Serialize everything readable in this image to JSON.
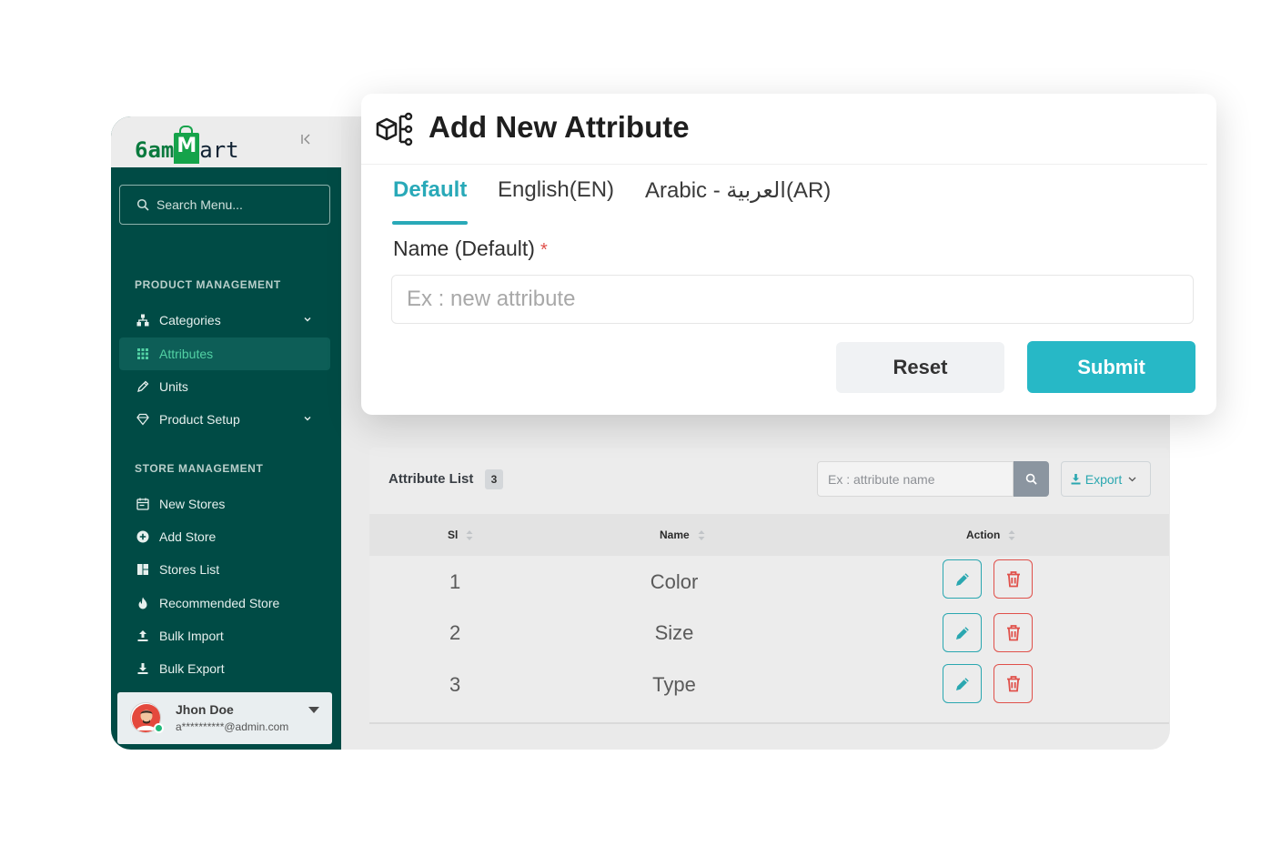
{
  "brand": {
    "logo_prefix": "6am",
    "logo_m": "M",
    "logo_suffix": "art",
    "collapse_icon": "collapse-left-icon"
  },
  "sidebar": {
    "search_placeholder": "Search Menu...",
    "sections": [
      {
        "label": "PRODUCT MANAGEMENT",
        "items": [
          {
            "label": "Categories",
            "icon": "sitemap-icon",
            "has_chevron": true
          },
          {
            "label": "Attributes",
            "icon": "grid-icon",
            "active": true
          },
          {
            "label": "Units",
            "icon": "ruler-pencil-icon"
          },
          {
            "label": "Product Setup",
            "icon": "diamond-icon",
            "has_chevron": true
          }
        ]
      },
      {
        "label": "STORE MANAGEMENT",
        "items": [
          {
            "label": "New Stores",
            "icon": "calendar-icon"
          },
          {
            "label": "Add Store",
            "icon": "plus-circle-icon"
          },
          {
            "label": "Stores List",
            "icon": "layout-icon"
          },
          {
            "label": "Recommended Store",
            "icon": "flame-icon"
          },
          {
            "label": "Bulk Import",
            "icon": "upload-icon"
          },
          {
            "label": "Bulk Export",
            "icon": "download-icon"
          }
        ]
      }
    ],
    "user": {
      "name": "Jhon Doe",
      "email": "a**********@admin.com"
    }
  },
  "modal": {
    "title": "Add New Attribute",
    "tabs": [
      "Default",
      "English(EN)",
      "Arabic - العربية(AR)"
    ],
    "active_tab": 0,
    "field_label": "Name (Default)",
    "required_mark": "*",
    "input_placeholder": "Ex : new attribute",
    "input_value": "",
    "reset_label": "Reset",
    "submit_label": "Submit"
  },
  "attribute_list": {
    "title": "Attribute List",
    "count": "3",
    "search_placeholder": "Ex : attribute name",
    "export_label": "Export",
    "columns": [
      "Sl",
      "Name",
      "Action"
    ],
    "rows": [
      {
        "sl": "1",
        "name": "Color"
      },
      {
        "sl": "2",
        "name": "Size"
      },
      {
        "sl": "3",
        "name": "Type"
      }
    ]
  },
  "colors": {
    "sidebar_bg": "#004b45",
    "accent_teal": "#29a9b8",
    "active_nav_text": "#52d1a4",
    "delete_red": "#e0504a",
    "submit_bg": "#27b8c6"
  }
}
